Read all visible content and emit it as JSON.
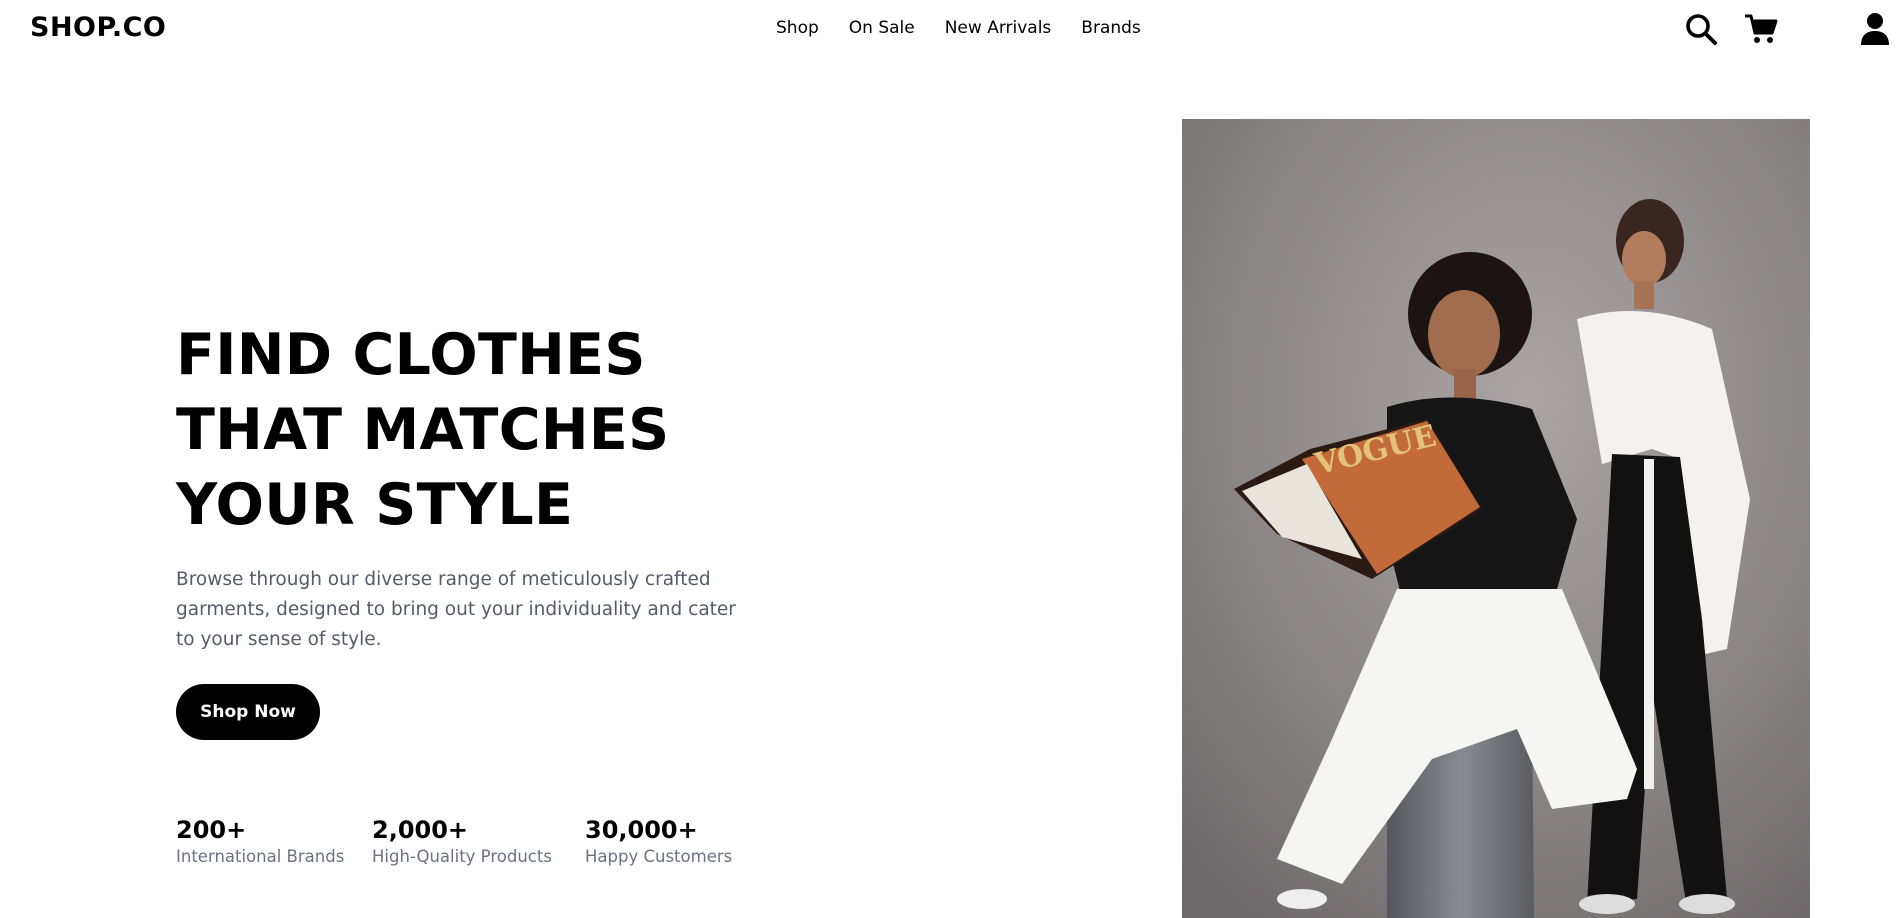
{
  "brand": {
    "logo": "SHOP.CO"
  },
  "nav": {
    "items": [
      {
        "label": "Shop"
      },
      {
        "label": "On Sale"
      },
      {
        "label": "New Arrivals"
      },
      {
        "label": "Brands"
      }
    ]
  },
  "header_icons": [
    "search-icon",
    "cart-icon",
    "user-icon"
  ],
  "hero": {
    "title_lines": [
      "FIND CLOTHES",
      "THAT MATCHES",
      "YOUR STYLE"
    ],
    "description": "Browse through our diverse range of meticulously crafted garments, designed to bring out your individuality and cater to your sense of style.",
    "cta_label": "Shop Now",
    "stats": [
      {
        "value": "200+",
        "label": "International Brands"
      },
      {
        "value": "2,000+",
        "label": "High-Quality Products"
      },
      {
        "value": "30,000+",
        "label": "Happy Customers"
      }
    ],
    "image_magazine_text": "VOGUE"
  },
  "colors": {
    "primary": "#000000",
    "background": "#ffffff",
    "muted_text": "#6b7280",
    "photo_backdrop": "#8a8585"
  }
}
